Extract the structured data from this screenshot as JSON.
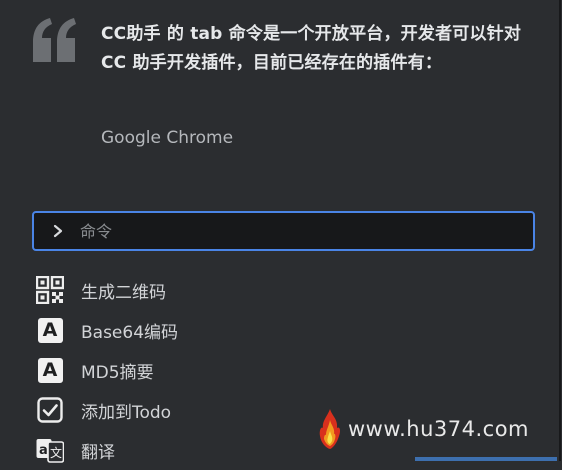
{
  "article": {
    "headline": "CC助手 的 tab 命令是一个开放平台，开发者可以针对 CC 助手开发插件，目前已经存在的插件有：",
    "plugins": [
      "Google Chrome"
    ]
  },
  "command_palette": {
    "input_placeholder": "命令",
    "input_value": "",
    "accent_color": "#4a84e6",
    "commands": [
      {
        "label": "生成二维码",
        "icon": "qr-code-icon"
      },
      {
        "label": "Base64编码",
        "icon": "letter-a-icon"
      },
      {
        "label": "MD5摘要",
        "icon": "letter-a-icon"
      },
      {
        "label": "添加到Todo",
        "icon": "checkbox-icon"
      },
      {
        "label": "翻译",
        "icon": "translate-icon"
      }
    ]
  },
  "watermark": {
    "text": "www.hu374.com"
  }
}
